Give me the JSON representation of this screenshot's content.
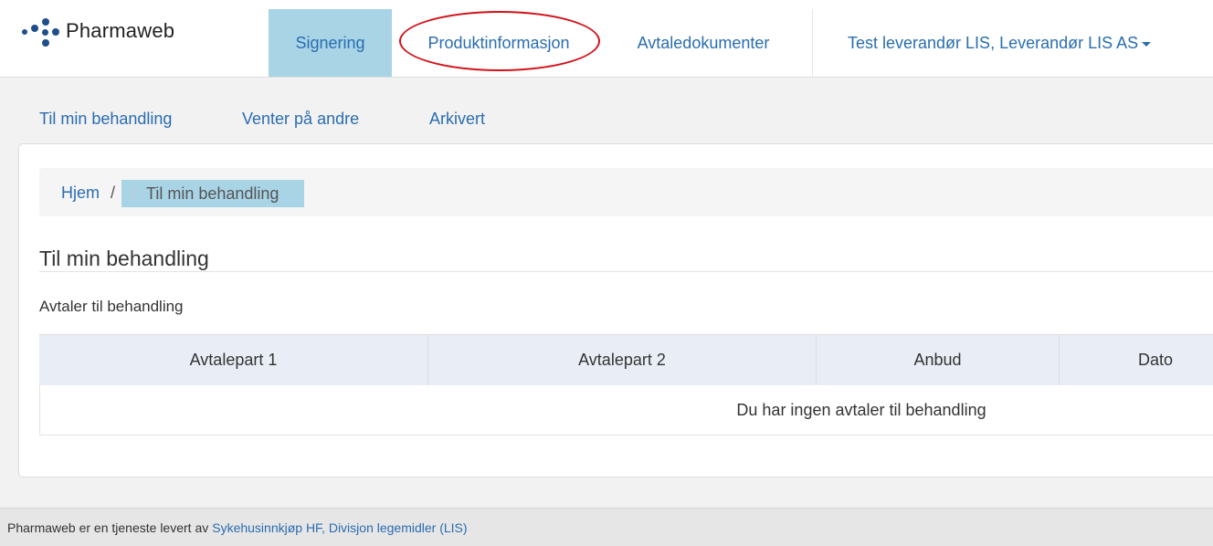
{
  "brand": {
    "name": "Pharmaweb"
  },
  "nav": {
    "items": [
      {
        "label": "Signering",
        "active": true
      },
      {
        "label": "Produktinformasjon",
        "active": false
      },
      {
        "label": "Avtaledokumenter",
        "active": false
      }
    ],
    "user": "Test leverandør LIS, Leverandør LIS AS"
  },
  "subnav": {
    "items": [
      {
        "label": "Til min behandling"
      },
      {
        "label": "Venter på andre"
      },
      {
        "label": "Arkivert"
      }
    ]
  },
  "breadcrumb": {
    "home": "Hjem",
    "separator": "/",
    "current": "Til min behandling"
  },
  "main": {
    "title": "Til min behandling",
    "section_label": "Avtaler til behandling",
    "table": {
      "columns": [
        "Avtalepart 1",
        "Avtalepart 2",
        "Anbud",
        "Dato"
      ],
      "empty_message": "Du har ingen avtaler til behandling"
    }
  },
  "footer": {
    "text": "Pharmaweb er en tjeneste levert av",
    "link": "Sykehusinnkjøp HF, Divisjon legemidler (LIS)"
  },
  "colors": {
    "accent": "#2a6db0",
    "active_nav_bg": "#a8d4e6",
    "highlight_ellipse": "#d3121b",
    "table_header_bg": "#e9eef6"
  },
  "icons": {
    "brand_logo": "pharmaweb-dots-icon",
    "user_caret": "caret-down-icon"
  }
}
